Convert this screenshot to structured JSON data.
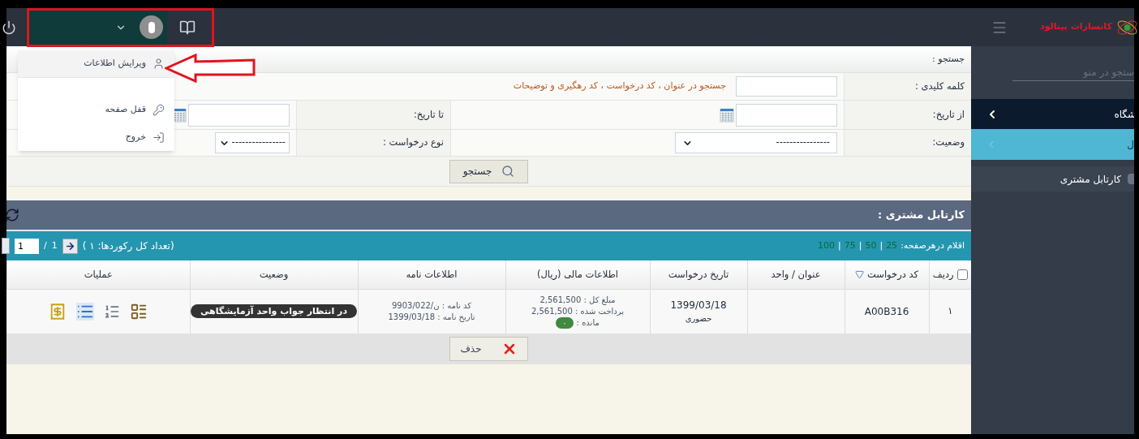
{
  "topbar": {
    "user_menu": {
      "items": [
        {
          "label": "ویرایش اطلاعات",
          "kind": "user",
          "selected": true
        },
        {
          "label": "قفل صفحه",
          "kind": "key",
          "selected": false
        },
        {
          "label": "خروج",
          "kind": "exit",
          "selected": false
        }
      ]
    },
    "logo": {
      "name": "کانسارات بینالود"
    }
  },
  "sidebar": {
    "search": {
      "placeholder": "ستجو در منو"
    },
    "items": [
      {
        "label": "شگاه",
        "kind": "section"
      },
      {
        "label": "ل",
        "kind": "subsection"
      },
      {
        "label": "کارتابل مشتری",
        "kind": "item"
      }
    ]
  },
  "search": {
    "title": "جستجو :",
    "keyword": {
      "label": "کلمه کلیدی :",
      "hint": "جستجو در عنوان ، کد درخواست ، کد رهگیری و توضیحات"
    },
    "from_date": {
      "label": "از تاریخ:"
    },
    "to_date": {
      "label": "تا تاریخ:"
    },
    "status": {
      "label": "وضعیت:",
      "value": "----------------"
    },
    "request_type": {
      "label": "نوع درخواست :",
      "value": "----------------"
    },
    "button": "جستجو"
  },
  "cartable": {
    "title": "کارتابل مشتری :",
    "pager": {
      "per_page_label": "اقلام درهرصفحه:",
      "options": [
        "25",
        "50",
        "75",
        "100"
      ],
      "divider": "|",
      "total": "(تعداد کل رکوردها: ۱ )",
      "page_total": "1",
      "separator": "/",
      "page": "1"
    },
    "select_all": {
      "checked": false
    },
    "columns": [
      "ردیف",
      "کد درخواست",
      "عنوان / واحد",
      "تاریخ درخواست",
      "اطلاعات مالی (ریال)",
      "اطلاعات نامه",
      "وضعیت",
      "عملیات"
    ],
    "rows": [
      {
        "index": "۱",
        "code": "A00B316",
        "date": "1399/03/18",
        "date_note": "حضوری",
        "finance": [
          "مبلغ کل : 2,561,500",
          "پرداخت شده : 2,561,500"
        ],
        "remaining_label": "مانده :",
        "remaining": "۰",
        "letter": [
          "کد نامه : ن/9903/022",
          "تاریخ نامه : 1399/03/18"
        ],
        "status": "در انتظار جواب واحد آزمایشگاهی"
      }
    ],
    "delete_button": "حذف"
  }
}
